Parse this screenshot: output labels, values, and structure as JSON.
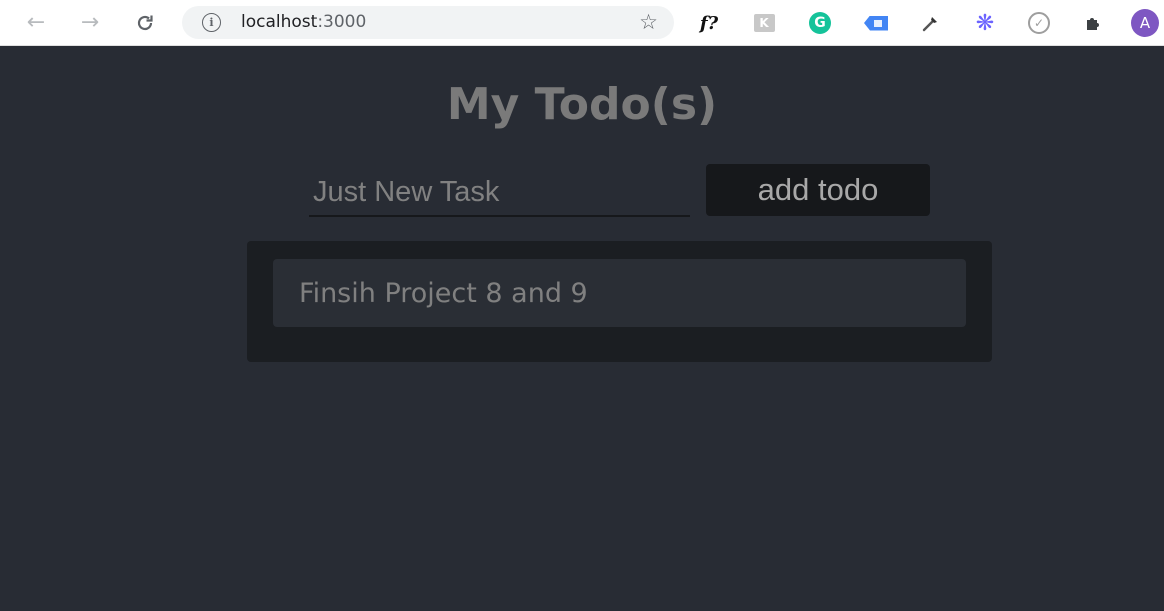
{
  "browser": {
    "url_host": "localhost",
    "url_port": ":3000",
    "icons": {
      "back": "back-arrow-icon",
      "forward": "forward-arrow-icon",
      "reload": "reload-icon",
      "info": "info-icon",
      "star": "bookmark-star-icon",
      "extensions": [
        "whatfont-icon",
        "extension-k-icon",
        "grammarly-icon",
        "tag-extension-icon",
        "color-picker-icon",
        "sparkle-extension-icon",
        "compass-extension-icon",
        "extensions-puzzle-icon"
      ]
    },
    "fonts_ext_label": "f?",
    "grammarly_label": "G",
    "avatar_initial": "A"
  },
  "app": {
    "title": "My Todo(s)",
    "input": {
      "placeholder": "Just New Task",
      "value": ""
    },
    "add_button_label": "add todo",
    "todos": [
      {
        "text": "Finsih Project 8 and 9"
      }
    ]
  },
  "colors": {
    "page_background": "#282c34",
    "panel_background": "#1b1e22",
    "item_background": "#2a2e35",
    "button_background": "#16181b",
    "title_text": "#7a7a7a",
    "avatar": "#7e57c2"
  }
}
